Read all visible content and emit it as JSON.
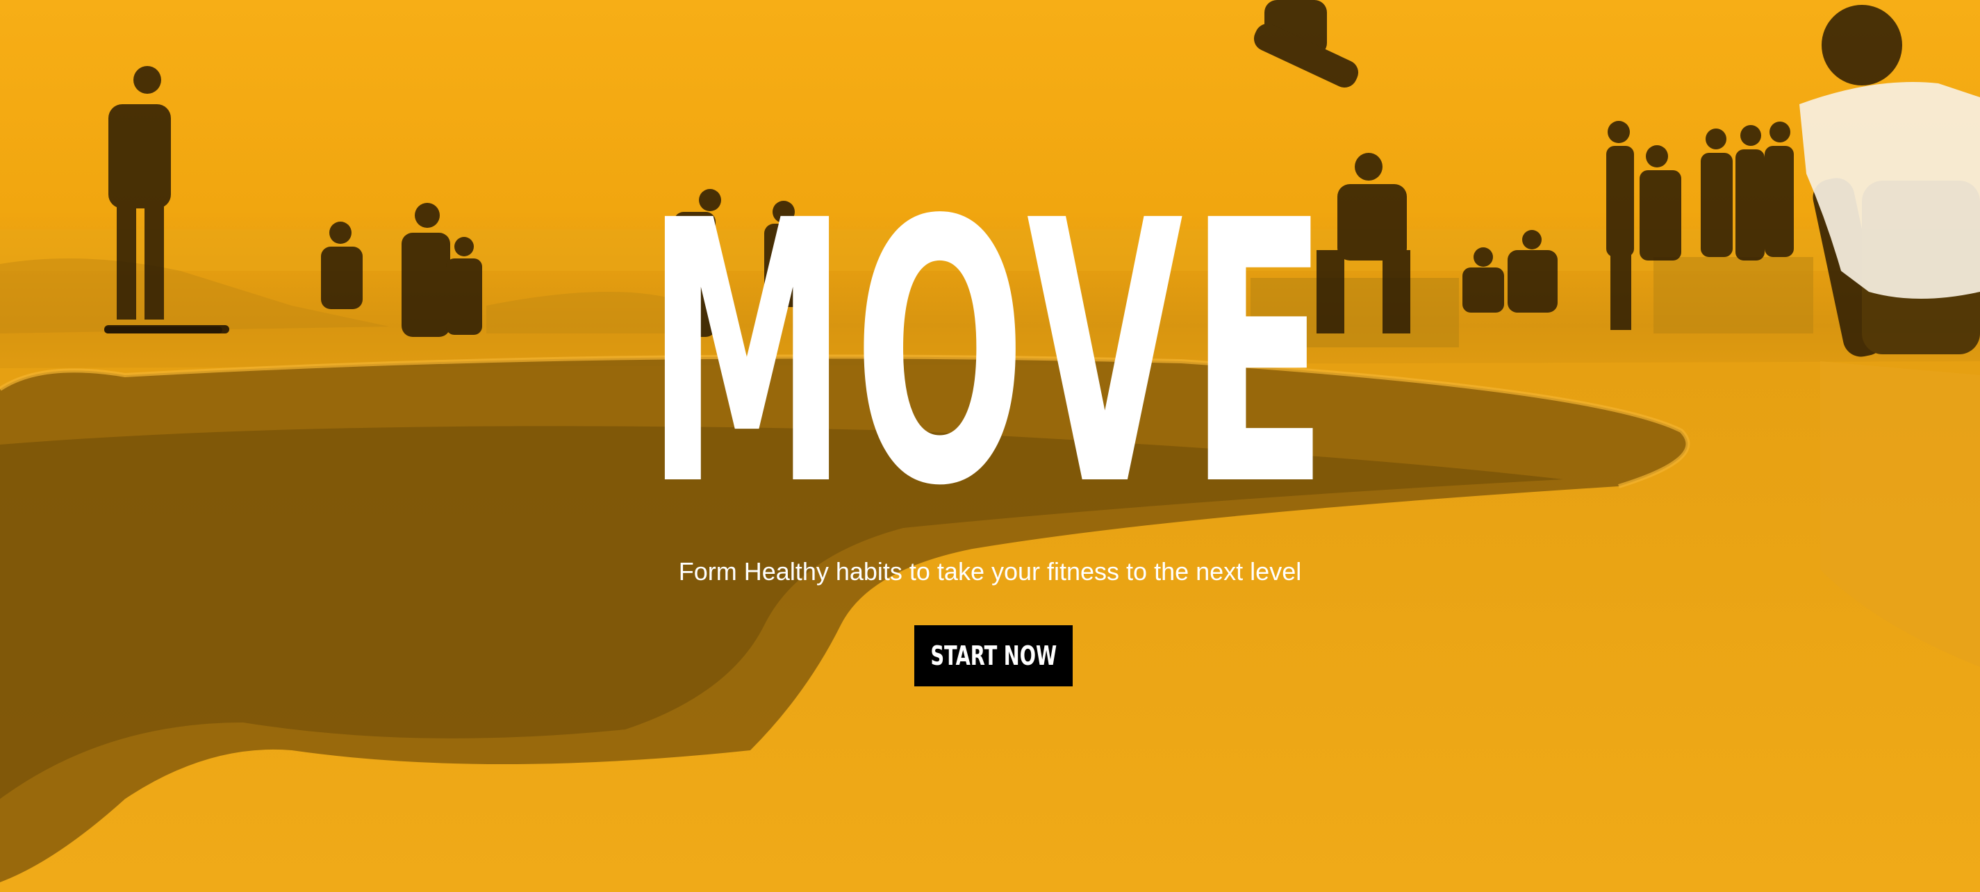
{
  "hero": {
    "title": "MOVE",
    "subtitle": "Form Healthy habits to take your fitness to the next level",
    "cta_label": "START NOW",
    "background_image": "skatepark-photo"
  },
  "colors": {
    "overlay": "#f2a200",
    "title_text": "#ffffff",
    "subtitle_text": "#ffffff",
    "cta_background": "#000000",
    "cta_text": "#ffffff"
  }
}
